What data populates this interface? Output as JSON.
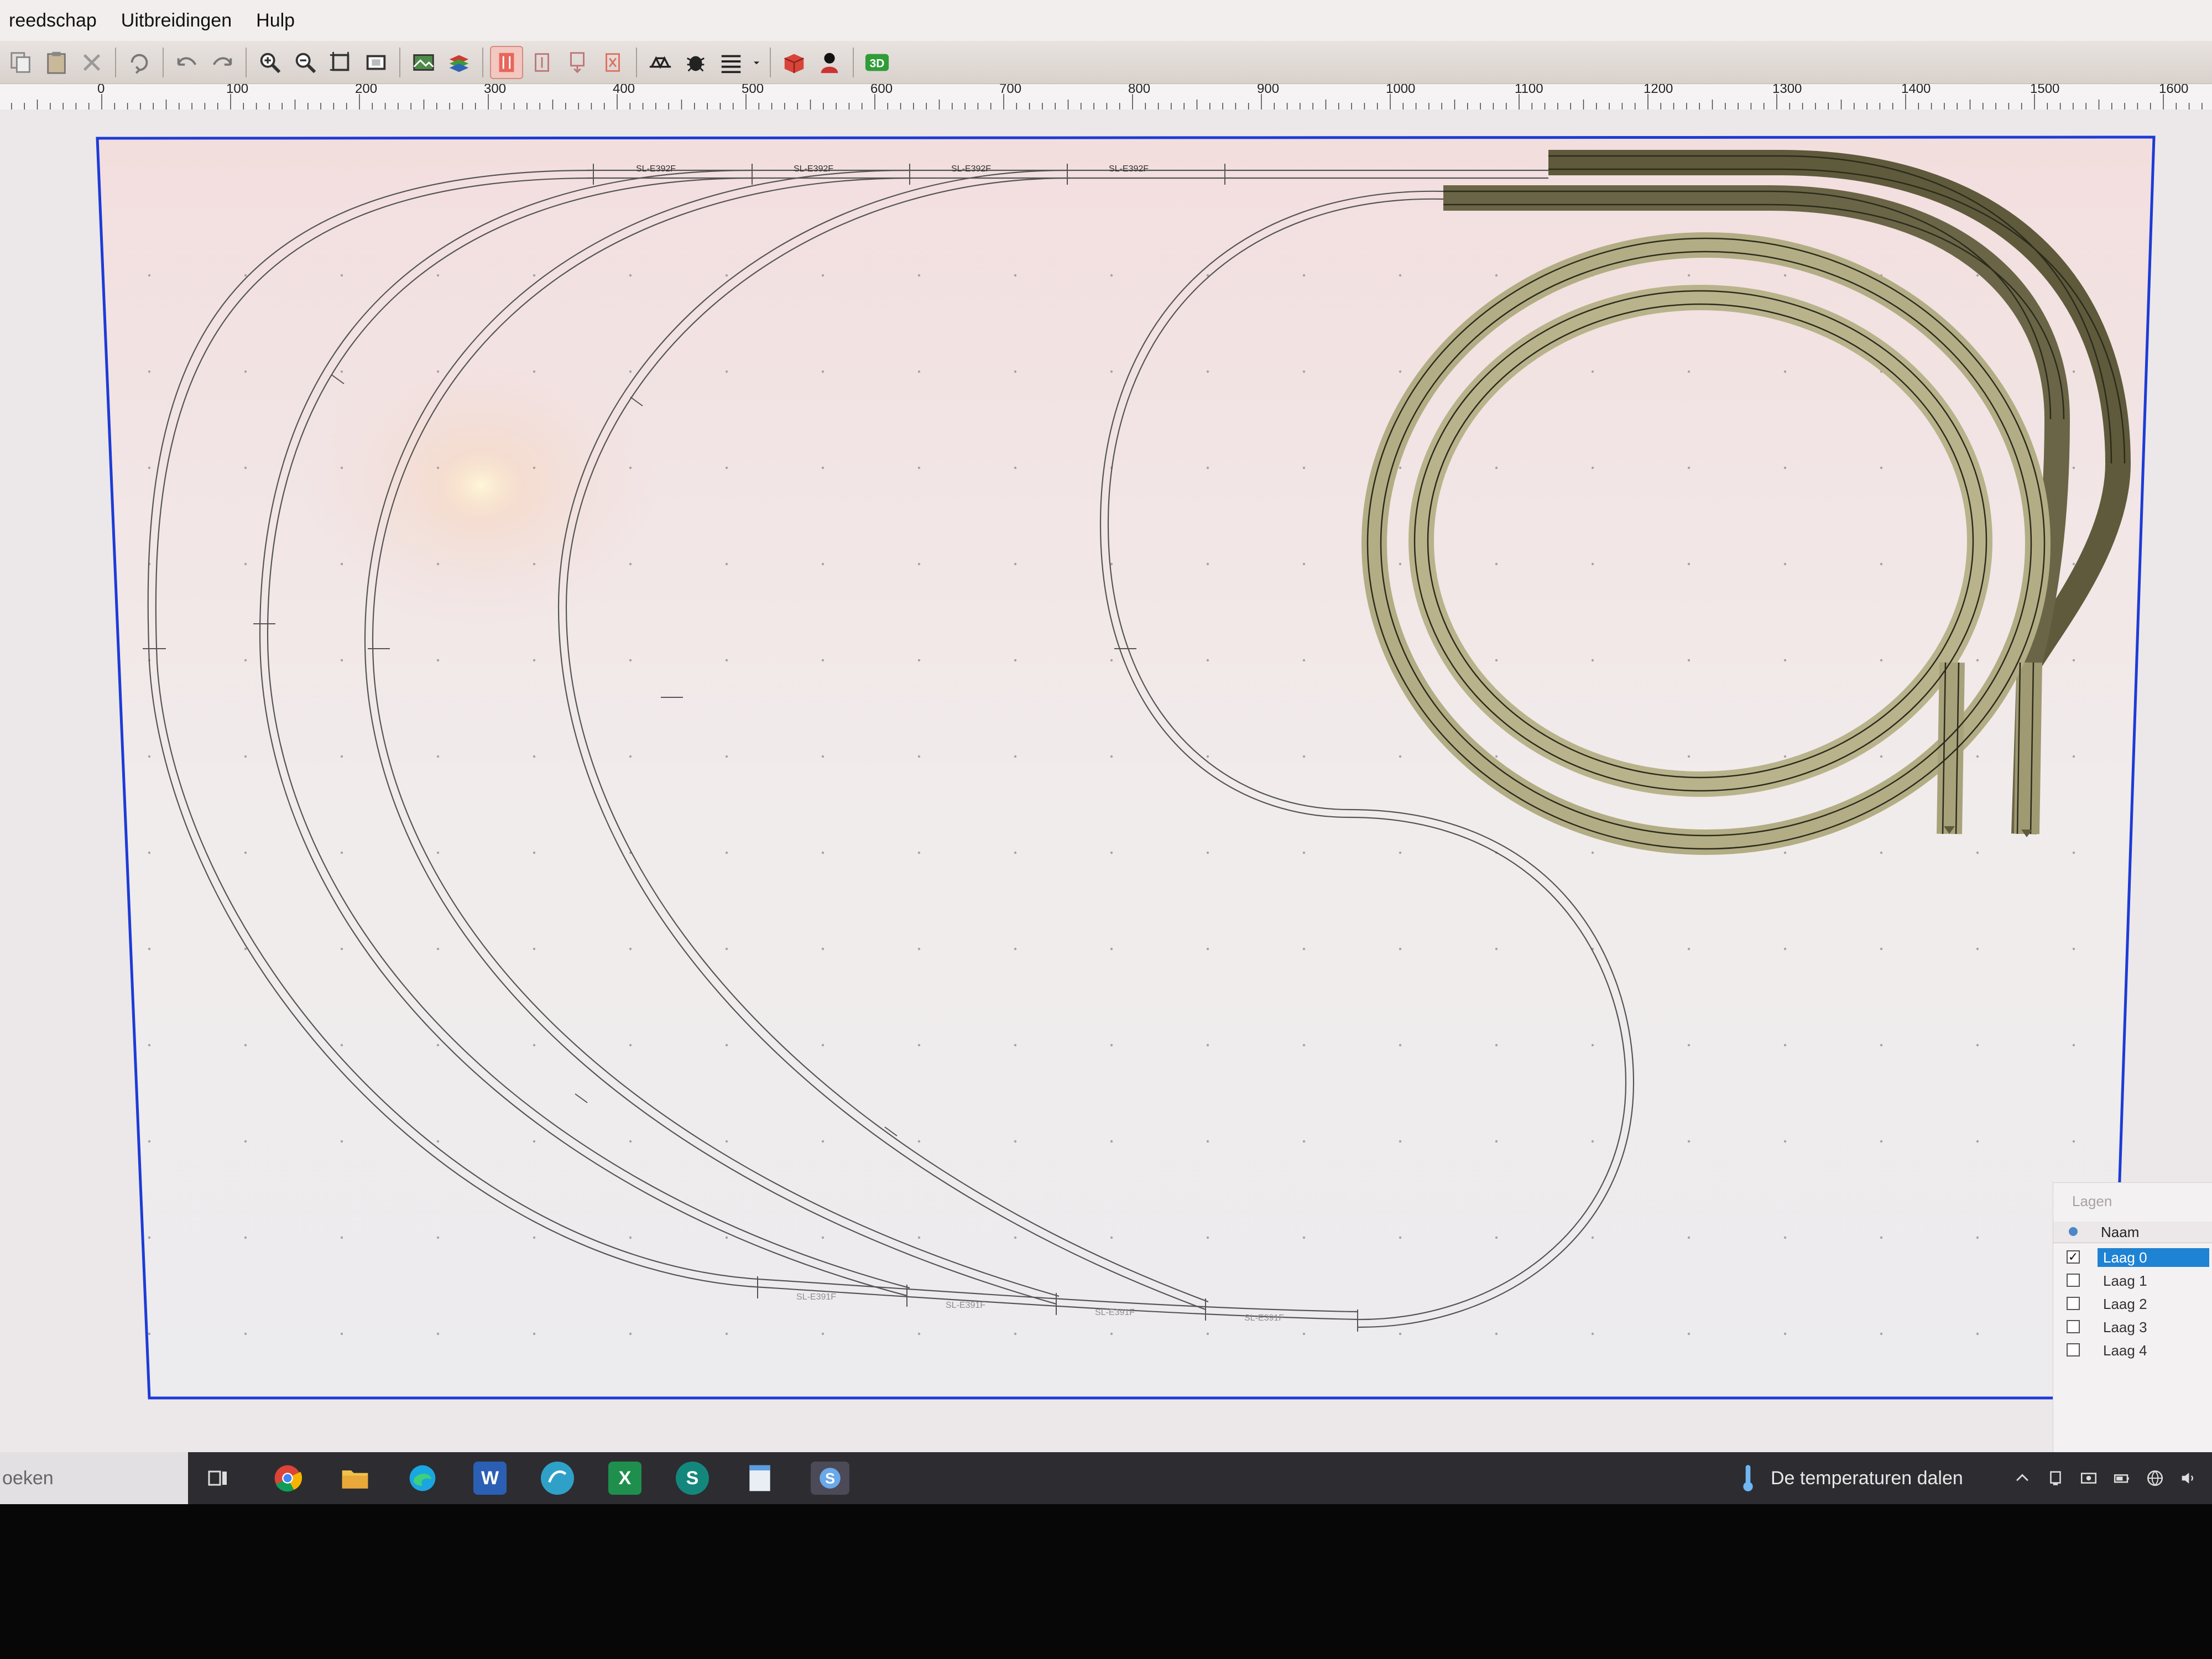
{
  "menu": {
    "items": [
      "reedschap",
      "Uitbreidingen",
      "Hulp"
    ]
  },
  "toolbar": {
    "tool_3d_label": "3D"
  },
  "ruler": {
    "labels": [
      "0",
      "100",
      "200",
      "300",
      "400",
      "500",
      "600",
      "700",
      "800",
      "900",
      "1000",
      "1100",
      "1200",
      "1300",
      "1400",
      "1500",
      "1600"
    ]
  },
  "track_labels": {
    "top": [
      "SL-E392F",
      "SL-E392F",
      "SL-E392F",
      "SL-E392F"
    ],
    "bottom": [
      "SL-E391F",
      "SL-E391F",
      "SL-E391F",
      "SL-E391F"
    ]
  },
  "layers": {
    "title": "Lagen",
    "column": "Naam",
    "items": [
      {
        "name": "Laag 0",
        "checked": true,
        "selected": true
      },
      {
        "name": "Laag 1",
        "checked": false,
        "selected": false
      },
      {
        "name": "Laag 2",
        "checked": false,
        "selected": false
      },
      {
        "name": "Laag 3",
        "checked": false,
        "selected": false
      },
      {
        "name": "Laag 4",
        "checked": false,
        "selected": false
      }
    ]
  },
  "taskbar": {
    "search_text": "oeken",
    "weather_text": "De temperaturen dalen",
    "icons": [
      "task-view-icon",
      "chrome-icon",
      "file-explorer-icon",
      "edge-icon",
      "word-icon",
      "browser-icon",
      "excel-icon",
      "sharepoint-icon",
      "notepad-icon",
      "skype-icon"
    ]
  },
  "colors": {
    "board_border": "#1d3bd6",
    "track_line": "#555555",
    "raised_track_fill": "#b2ad84",
    "raised_track_dark": "#5e5a3b",
    "selection_blue": "#1f83d4"
  }
}
